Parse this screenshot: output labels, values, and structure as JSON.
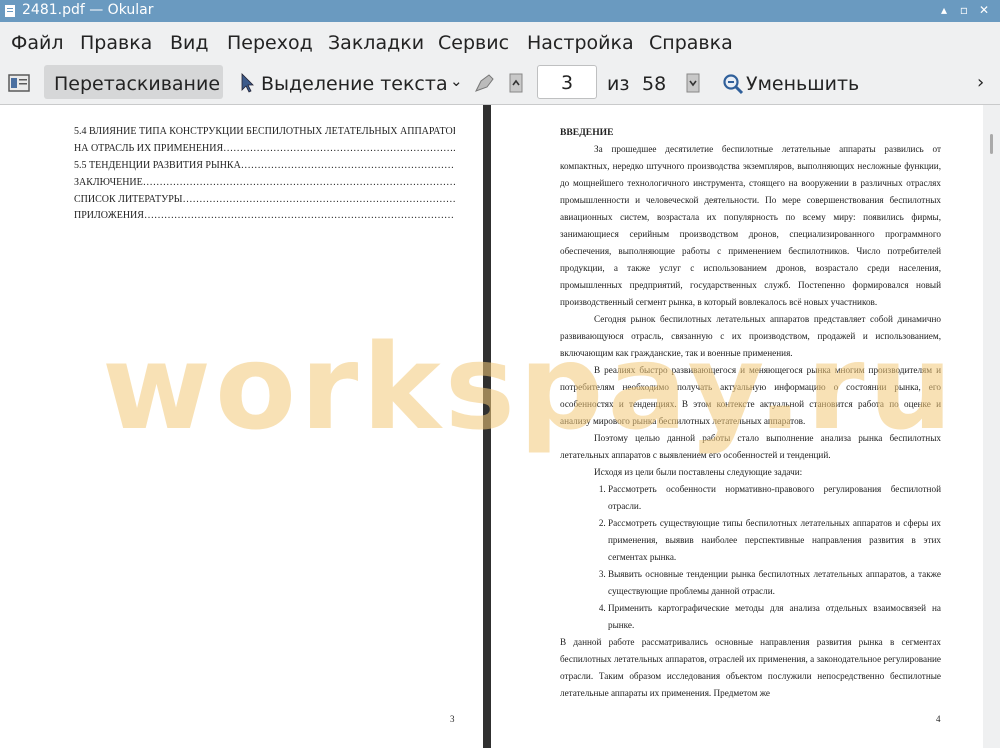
{
  "window": {
    "title": "2481.pdf  — Okular"
  },
  "menu": [
    "Файл",
    "Правка",
    "Вид",
    "Переход",
    "Закладки",
    "Сервис",
    "Настройка",
    "Справка"
  ],
  "toolbar": {
    "browse_label": "Перетаскивание",
    "select_label": "Выделение текста",
    "page_value": "3",
    "of_label": "из",
    "total_pages": "58",
    "zoom_out_label": "Уменьшить"
  },
  "left_page": {
    "toc": [
      "5.4 ВЛИЯНИЕ ТИПА КОНСТРУКЦИИ БЕСПИЛОТНЫХ ЛЕТАТЕЛЬНЫХ АППАРАТОВ",
      "НА ОТРАСЛЬ ИХ ПРИМЕНЕНИЯ……………………………………………………………..49",
      "5.5 ТЕНДЕНЦИИ РАЗВИТИЯ РЫНКА…………………………………………………………50",
      "ЗАКЛЮЧЕНИЕ………………………………………………………………………………………54",
      "СПИСОК ЛИТЕРАТУРЫ…………………………………………………………………………56",
      "ПРИЛОЖЕНИЯ………………………………………………………………………………………..59"
    ],
    "page_number": "3"
  },
  "right_page": {
    "heading": "ВВЕДЕНИЕ",
    "para1": "За прошедшее десятилетие беспилотные летательные аппараты развились от компактных, нередко штучного производства экземпляров, выполняющих несложные функции, до мощнейшего технологичного инструмента, стоящего на вооружении в различных отраслях промышленности и человеческой деятельности. По мере совершенствования беспилотных авиационных систем, возрастала их популярность по всему миру: появились фирмы, занимающиеся серийным производством дронов, специализированного программного обеспечения, выполняющие работы с применением беспилотников. Число потребителей продукции, а также услуг с использованием дронов, возрастало среди населения, промышленных предприятий, государственных служб. Постепенно формировался новый производственный сегмент рынка, в который вовлекалось всё новых участников.",
    "para2": "Сегодня рынок беспилотных летательных аппаратов представляет собой динамично развивающуюся отрасль, связанную с их производством, продажей и использованием, включающим как гражданские, так и военные применения.",
    "para3": "В реалиях быстро развивающегося и меняющегося рынка многим производителям и потребителям необходимо получать актуальную информацию о состоянии рынка, его особенностях и тенденциях. В этом контексте актуальной становится работа по оценке и анализу мирового рынка беспилотных летательных аппаратов.",
    "para4": "Поэтому целью данной работы стало выполнение анализа рынка беспилотных летательных аппаратов с выявлением его особенностей и тенденций.",
    "para5": "Исходя из цели были поставлены следующие задачи:",
    "tasks": [
      "Рассмотреть особенности нормативно-правового регулирования беспилотной отрасли.",
      "Рассмотреть существующие типы беспилотных летательных аппаратов и сферы их применения, выявив наиболее перспективные направления развития в этих сегментах рынка.",
      "Выявить основные тенденции рынка беспилотных летательных аппаратов, а также существующие проблемы данной отрасли.",
      "Применить картографические методы для анализа отдельных взаимосвязей на рынке."
    ],
    "para6": "В данной работе рассматривались основные направления развития рынка в сегментах беспилотных летательных аппаратов, отраслей их применения, а законодательное регулирование отрасли. Таким образом исследования объектом послужили непосредственно беспилотные летательные аппараты их применения. Предметом же",
    "page_number": "4"
  },
  "watermark": "workspay.ru"
}
